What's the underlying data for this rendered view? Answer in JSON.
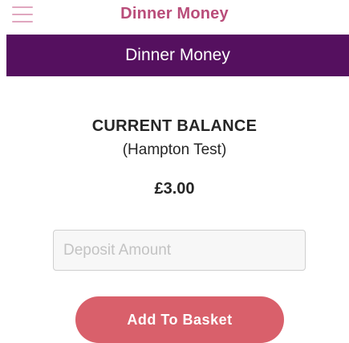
{
  "header": {
    "title": "Dinner Money",
    "menu_icon": "hamburger-menu-icon"
  },
  "banner": {
    "title": "Dinner Money"
  },
  "balance": {
    "heading": "CURRENT BALANCE",
    "account": "(Hampton Test)",
    "amount": "£3.00"
  },
  "deposit": {
    "placeholder": "Deposit Amount",
    "value": ""
  },
  "actions": {
    "add_to_basket_label": "Add To Basket"
  },
  "colors": {
    "title_pink": "#b94d7a",
    "banner_purple": "#55105f",
    "button_coral": "#d9606b"
  }
}
